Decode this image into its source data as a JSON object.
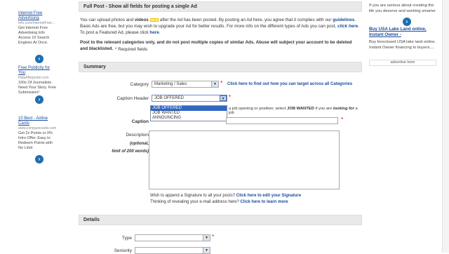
{
  "left_ads": [
    {
      "title": "Internet Free Advertising",
      "url": "Info.com/InternetFree...",
      "desc": "Get Internet Free Advertising Info Access 10 Search Engines At Once."
    },
    {
      "title": "Free Publicity for You",
      "url": "HelpAReporter.com",
      "desc": "100s Of Journalists Need Your Story. Free Submission!"
    },
    {
      "title": "10 Best - Airline Cards",
      "url": "www.comparecards.com",
      "desc": "Get 2x Points or 0% Intro Offer. Easy to Redeem Points with No Limit"
    }
  ],
  "main": {
    "header": "Full Post - Show all fields for posting a single Ad",
    "intro_pre": "You can upload photos and ",
    "intro_videos": "videos",
    "intro_new": "NEW",
    "intro_mid": " after the Ad has been posted. By posting an Ad here, you agree that it complies with our ",
    "intro_guidelines": "guidelines",
    "intro_rest": ". Basic Ads are free, but you may wish to upgrade your Ad for better results. For more info on the different types of Ads you can post, ",
    "intro_clickhere": "click here",
    "intro_end": ". To post a Featured Ad, please click ",
    "intro_here": "here",
    "warn": "Post to the relevant categories only, and do not post multiple copies of similar Ads. Abuse will subject your account to be deleted and blacklisted.",
    "required_note": "* Required fields",
    "summary_title": "Summary",
    "category_label": "Category",
    "category_value": "Marketing / Sales",
    "category_link": "Click here to find out how you can target across all Categories",
    "caption_header_label": "Caption Header",
    "caption_header_value": "JOB OFFERED",
    "caption_hint_pre": "a job opening or position; select ",
    "caption_hint_wanted": "JOB WANTED",
    "caption_hint_post": " if you are ",
    "caption_hint_looking": "looking for",
    "caption_hint_end": " a job",
    "dropdown_options": [
      "JOB OFFERED",
      "JOB WANTED",
      "ANNOUNCING"
    ],
    "caption_label": "Caption",
    "description_label": "Description",
    "optional": "(optional,",
    "limit": "limit of 200 words)",
    "signature_text": "Wish to append a Signature to all your posts? ",
    "signature_link": "Click here to edit your Signature",
    "email_text": "Thinking of revealing your e-mail address here? ",
    "email_link": "Click here to learn more",
    "details_title": "Details",
    "type_label": "Type",
    "seniority_label": "Seniority"
  },
  "right": {
    "text1": "If you are serious about creating the life you deserve and working smarter",
    "ad_title": "Buy USA Lake Land online, Instant Owner -",
    "ad_desc": "Buy foreclosed USA lake land online. Instant Owner financing to buyers....",
    "advertise": "advertise here"
  }
}
